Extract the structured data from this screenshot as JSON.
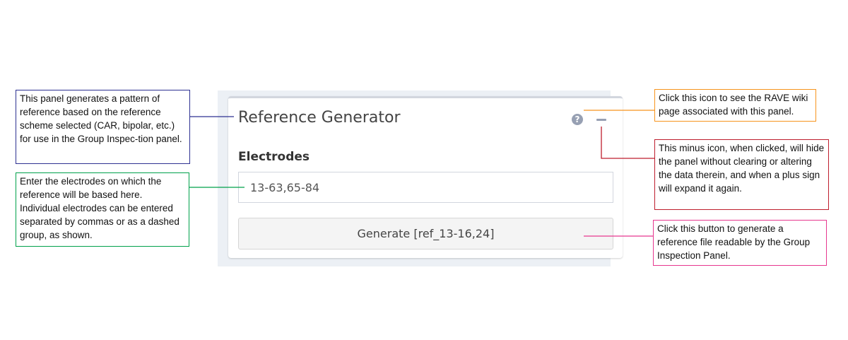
{
  "panel": {
    "title": "Reference Generator",
    "help_icon": "question-circle-icon",
    "collapse_icon": "minus-icon",
    "electrodes_label": "Electrodes",
    "electrodes_value": "13-63,65-84",
    "generate_button_label": "Generate [ref_13-16,24]"
  },
  "annotations": {
    "panel_description": "This panel generates a pattern of reference based on the reference scheme selected (CAR, bipolar, etc.) for use in the Group Inspec-tion panel.",
    "electrodes_description": "Enter the electrodes on which the reference will be based here. Individual electrodes can be entered separated by commas or as a dashed group, as shown.",
    "help_description": "Click this icon to see the RAVE wiki page associated with this panel.",
    "minus_description": "This minus icon, when clicked, will hide the panel without clearing or altering the data therein, and when a plus sign will expand it again.",
    "generate_description": "Click this button to generate a reference file readable by the Group Inspection Panel."
  },
  "colors": {
    "panel_callout": "#2e3192",
    "electrodes_callout": "#00a14b",
    "help_callout": "#f7941d",
    "minus_callout": "#be1e2d",
    "generate_callout": "#e6388f"
  }
}
